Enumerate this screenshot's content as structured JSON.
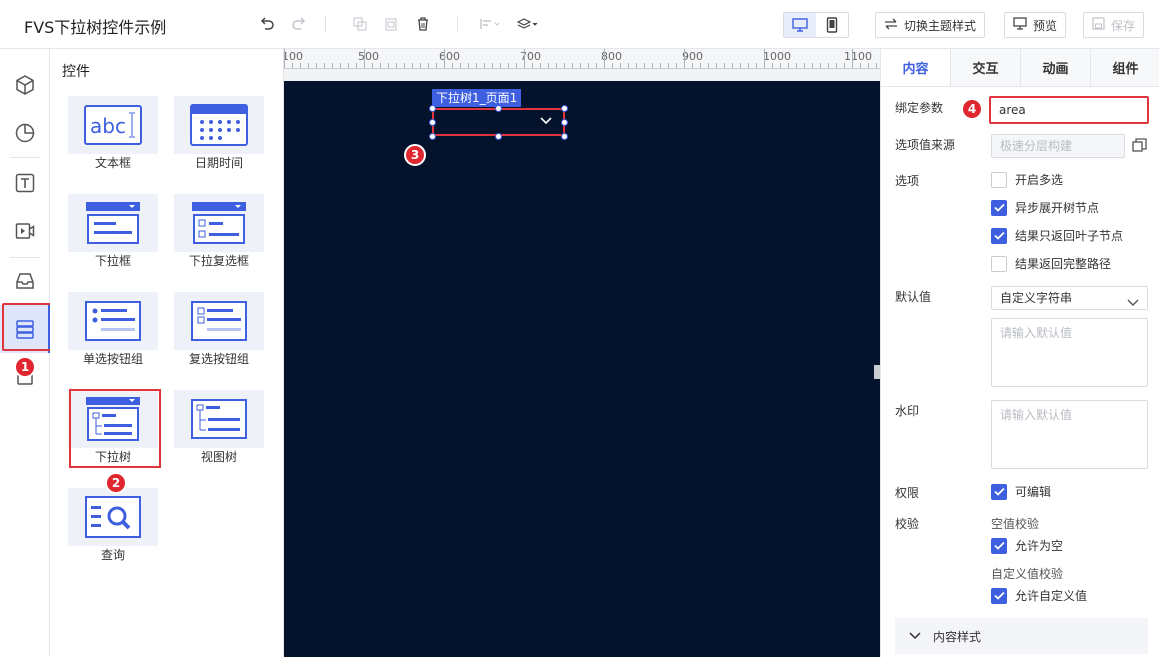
{
  "app": {
    "title": "FVS下拉树控件示例"
  },
  "toolbar": {
    "undo_icon": "undo-icon",
    "redo_icon": "redo-icon",
    "copy_icon": "copy-icon",
    "paste_icon": "paste-icon",
    "delete_icon": "trash-icon",
    "align_icon": "align-icon",
    "layer_icon": "layers-icon",
    "desktop_icon": "desktop-icon",
    "mobile_icon": "mobile-icon",
    "theme_label": "切换主题样式",
    "preview_label": "预览",
    "save_label": "保存"
  },
  "rail": {
    "items": [
      "cube-icon",
      "pie-chart-icon",
      "text-icon",
      "video-icon",
      "inbox-icon",
      "widget-list-icon",
      "box-icon"
    ],
    "active_index": 5
  },
  "controls_panel": {
    "header": "控件",
    "items": [
      {
        "label": "文本框",
        "icon": "textbox-thumb"
      },
      {
        "label": "日期时间",
        "icon": "datetime-thumb"
      },
      {
        "label": "下拉框",
        "icon": "dropdown-thumb"
      },
      {
        "label": "下拉复选框",
        "icon": "dropdown-checkbox-thumb"
      },
      {
        "label": "单选按钮组",
        "icon": "radio-group-thumb"
      },
      {
        "label": "复选按钮组",
        "icon": "checkbox-group-thumb"
      },
      {
        "label": "下拉树",
        "icon": "dropdown-tree-thumb"
      },
      {
        "label": "视图树",
        "icon": "view-tree-thumb"
      },
      {
        "label": "查询",
        "icon": "query-thumb"
      }
    ]
  },
  "badges": {
    "b1": "1",
    "b2": "2",
    "b3": "3",
    "b4": "4"
  },
  "ruler": {
    "labels": [
      "100",
      "500",
      "600",
      "700",
      "800",
      "900",
      "1000",
      "1100"
    ]
  },
  "canvas": {
    "component_tag": "下拉树1_页面1"
  },
  "props": {
    "tabs": [
      "内容",
      "交互",
      "动画",
      "组件"
    ],
    "active_tab": 0,
    "bind_param_label": "绑定参数",
    "bind_param_value": "area",
    "option_source_label": "选项值来源",
    "option_source_placeholder": "极速分层构建",
    "options_label": "选项",
    "options": [
      {
        "label": "开启多选",
        "checked": false
      },
      {
        "label": "异步展开树节点",
        "checked": true
      },
      {
        "label": "结果只返回叶子节点",
        "checked": true
      },
      {
        "label": "结果返回完整路径",
        "checked": false
      }
    ],
    "default_label": "默认值",
    "default_select": "自定义字符串",
    "default_placeholder": "请输入默认值",
    "watermark_label": "水印",
    "watermark_placeholder": "请输入默认值",
    "permission_label": "权限",
    "permission_check": "可编辑",
    "validation_label": "校验",
    "empty_validation": "空值校验",
    "allow_empty": "允许为空",
    "custom_validation": "自定义值校验",
    "allow_custom": "允许自定义值",
    "section_content_style": "内容样式"
  },
  "colors": {
    "accent": "#3d5fe0",
    "highlight": "#e0353d",
    "canvas_bg": "#04122c"
  }
}
